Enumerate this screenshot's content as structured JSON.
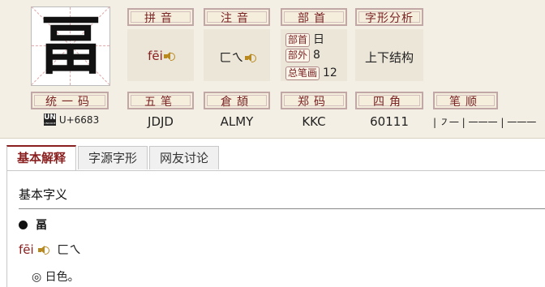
{
  "char": {
    "glyph": "畐"
  },
  "labels": {
    "pinyin": "拼音",
    "zhuyin": "注音",
    "bushou": "部首",
    "zixing": "字形分析",
    "tongyima": "统一码",
    "wubi": "五笔",
    "cangjie": "倉頡",
    "zhengma": "郑码",
    "sijiao": "四角",
    "bishun": "笔顺"
  },
  "values": {
    "pinyin": "fēi",
    "zhuyin": "ㄈㄟ",
    "bushou": {
      "radical_tag": "部首",
      "radical": "日",
      "outside_tag": "部外",
      "outside": "8",
      "total_tag": "总笔画",
      "total": "12"
    },
    "zixing": "上下结构",
    "unicode": "U+6683",
    "unicode_logo": "UNICODE",
    "wubi": "JDJD",
    "cangjie": "ALMY",
    "zhengma": "KKC",
    "sijiao": "60111",
    "bishun": "| ㇇一 | 一一一 | 一一一"
  },
  "tabs": [
    "基本解释",
    "字源字形",
    "网友讨论"
  ],
  "content": {
    "section_title": "基本字义",
    "entry_char": "畐",
    "entry_pinyin": "fēi",
    "entry_zhuyin": "ㄈㄟ",
    "definition": "◎ 日色。"
  },
  "colors": {
    "accent": "#8a1f1f",
    "panel": "#f3efe4",
    "label_border": "#c2a7a7"
  },
  "icons": [
    "speaker-icon",
    "unicode-logo-icon",
    "bullet-dot-icon"
  ]
}
